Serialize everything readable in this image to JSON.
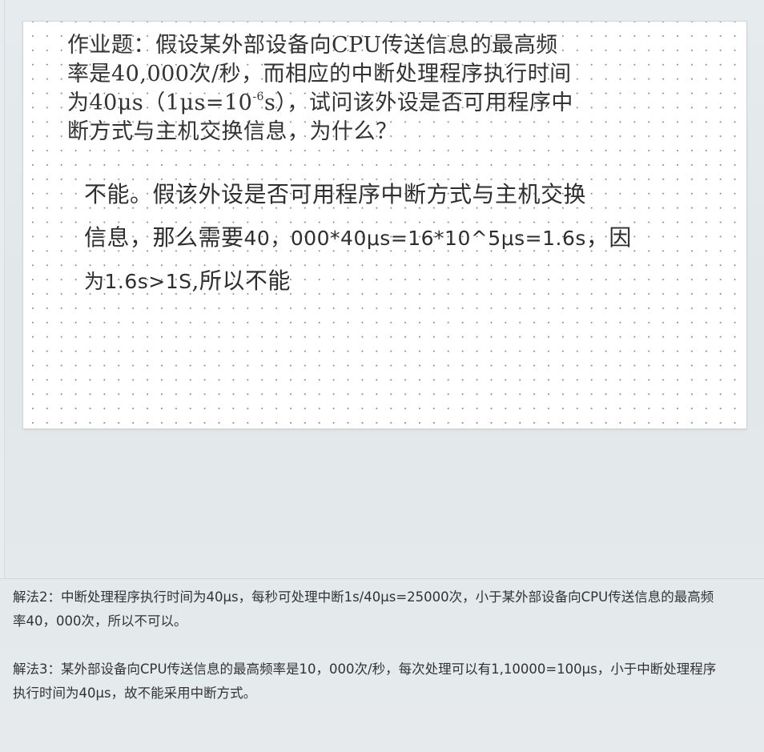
{
  "slide": {
    "question": {
      "line1": "作业题：假设某外部设备向CPU传送信息的最高频",
      "line2": "率是40,000次/秒，而相应的中断处理程序执行时间",
      "line3_pre": "为40μs（1μs=10",
      "line3_sup": "-6",
      "line3_post": "s），试问该外设是否可用程序中",
      "line4": "断方式与主机交换信息，为什么？"
    },
    "answer": {
      "line1": "不能。假该外设是否可用程序中断方式与主机交换",
      "line2_pre": "信息，那么需要",
      "line2_math": "40，000*40μs=16*10^5μs=1.6s",
      "line2_post": "，因",
      "line3_math": "为1.6s>1S",
      "line3_post": ",所以不能"
    }
  },
  "notes": {
    "method2_line1": "解法2：中断处理程序执行时间为40μs，每秒可处理中断1s/40μs=25000次，小于某外部设备向CPU传送信息的最高频",
    "method2_line2": "率40，000次，所以不可以。",
    "method3_line1": "解法3：某外部设备向CPU传送信息的最高频率是10，000次/秒，每次处理可以有1,10000=100μs，小于中断处理程序",
    "method3_line2": "执行时间为40μs，故不能采用中断方式。"
  }
}
